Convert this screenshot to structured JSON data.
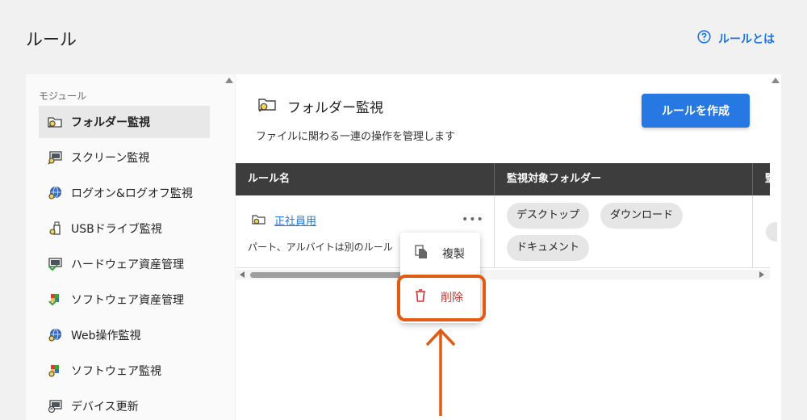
{
  "page": {
    "title": "ルール",
    "help_link": "ルールとは"
  },
  "sidebar": {
    "heading": "モジュール",
    "items": [
      {
        "label": "フォルダー監視",
        "icon": "folder-search-icon"
      },
      {
        "label": "スクリーン監視",
        "icon": "monitor-search-icon"
      },
      {
        "label": "ログオン&ログオフ監視",
        "icon": "logon-globe-icon"
      },
      {
        "label": "USBドライブ監視",
        "icon": "usb-drive-icon"
      },
      {
        "label": "ハードウェア資産管理",
        "icon": "hardware-monitor-icon"
      },
      {
        "label": "ソフトウェア資産管理",
        "icon": "software-asset-icon"
      },
      {
        "label": "Web操作監視",
        "icon": "web-globe-icon"
      },
      {
        "label": "ソフトウェア監視",
        "icon": "software-monitor-icon"
      },
      {
        "label": "デバイス更新",
        "icon": "device-update-icon"
      }
    ]
  },
  "module": {
    "title": "フォルダー監視",
    "description": "ファイルに関わる一連の操作を管理します",
    "create_button": "ルールを作成"
  },
  "table": {
    "headers": [
      "ルール名",
      "監視対象フォルダー",
      "監"
    ],
    "rows": [
      {
        "name": "正社員用",
        "description": "パート、アルバイトは別のルール",
        "folders": [
          "デスクトップ",
          "ダウンロード",
          "ドキュメント"
        ]
      }
    ]
  },
  "context_menu": {
    "copy_label": "複製",
    "delete_label": "削除"
  },
  "colors": {
    "accent": "#2778e2",
    "link": "#1a73e8",
    "danger": "#d0312d",
    "highlight": "#e35a12",
    "table_header": "#3d3d3d"
  }
}
